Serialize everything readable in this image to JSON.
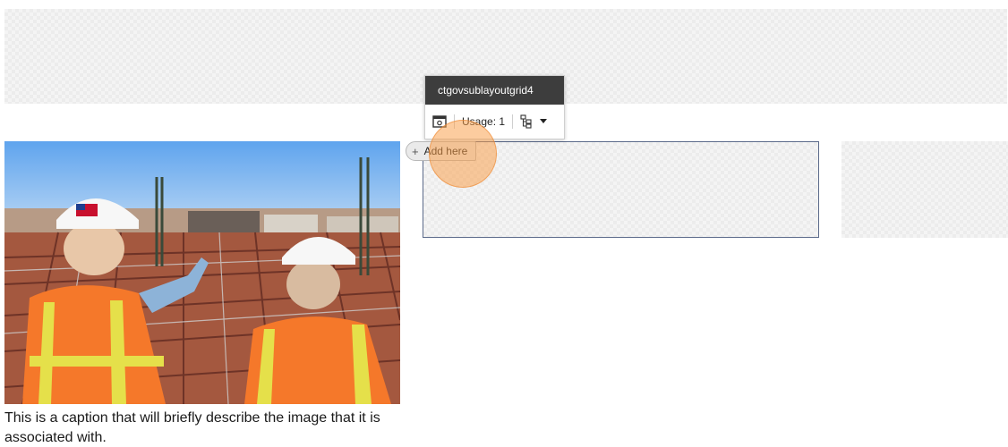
{
  "rendering_toolbar": {
    "title": "ctgovsublayoutgrid4",
    "usage_label": "Usage: 1",
    "preview_icon": "rendering-preview-icon",
    "tree_icon": "tree-structure-icon",
    "dropdown_icon": "caret-down-icon"
  },
  "add_here": {
    "label": "Add here",
    "icon": "+"
  },
  "image_block": {
    "photo_icon": "construction-workers-photo",
    "caption": "This is a caption that will briefly describe the image that it is associated with."
  },
  "colors": {
    "toolbar_header": "#3d3d3d",
    "grid_cell_border": "#5b6a8a",
    "click_highlight": "#f99e46",
    "placeholder_checker": "#f4f4f4"
  }
}
